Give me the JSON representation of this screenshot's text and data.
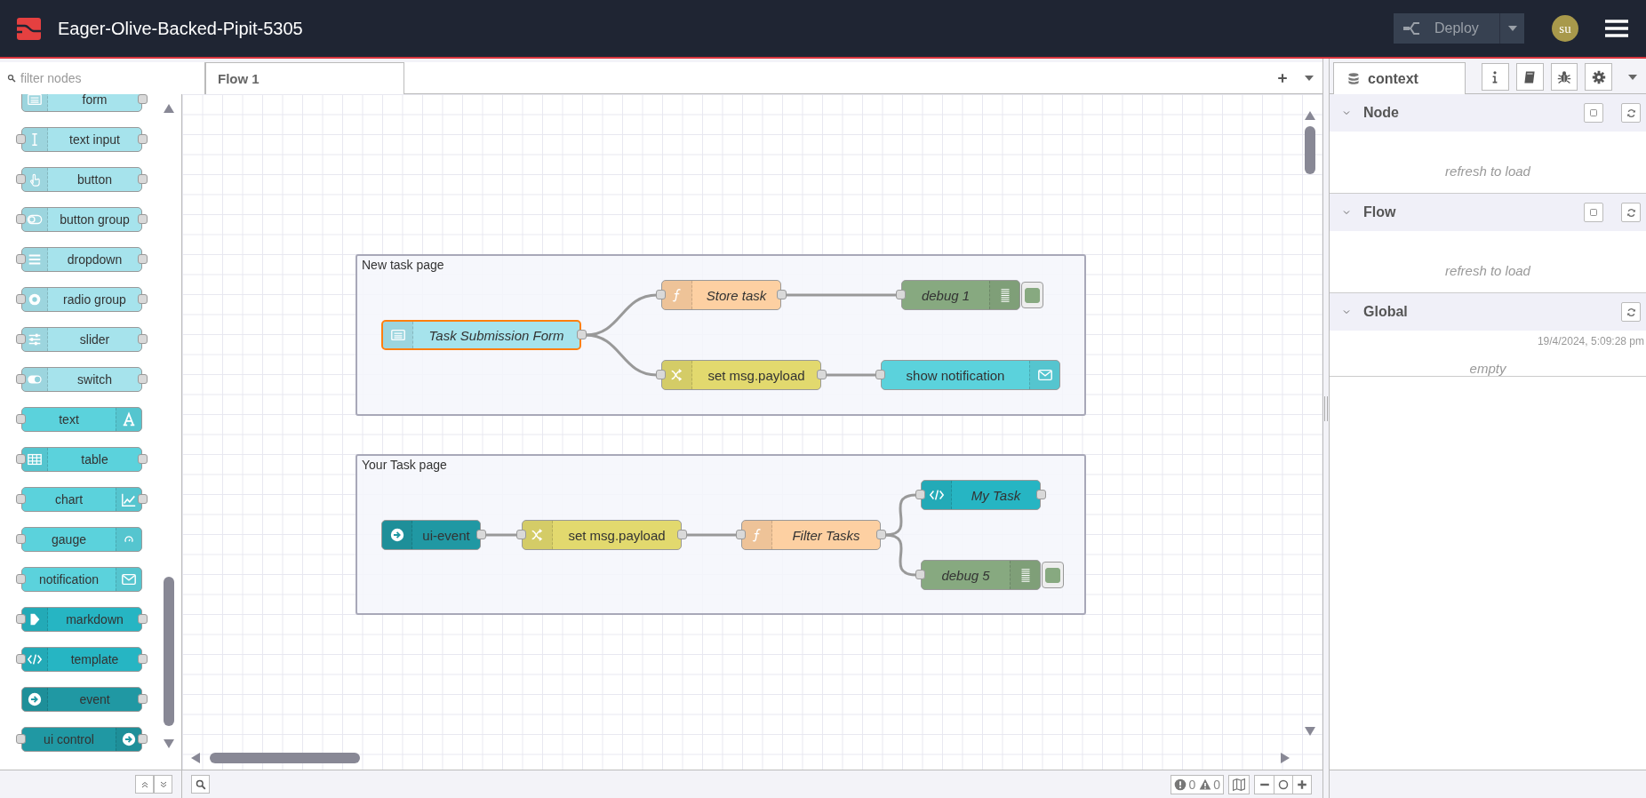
{
  "header": {
    "title": "Eager-Olive-Backed-Pipit-5305",
    "deploy": {
      "label": "Deploy",
      "disabled": true
    },
    "avatar": "su"
  },
  "palette": {
    "filter": {
      "placeholder": "filter nodes"
    },
    "nodes": [
      {
        "label": "form",
        "kind": "form",
        "color": "#a6e3ec",
        "input": false,
        "output": true
      },
      {
        "label": "text input",
        "kind": "text-input",
        "color": "#a6e3ec",
        "input": true,
        "output": true
      },
      {
        "label": "button",
        "kind": "button",
        "color": "#a6e3ec",
        "input": true,
        "output": true
      },
      {
        "label": "button group",
        "kind": "button-group",
        "color": "#a6e3ec",
        "input": true,
        "output": true
      },
      {
        "label": "dropdown",
        "kind": "dropdown",
        "color": "#a6e3ec",
        "input": true,
        "output": true
      },
      {
        "label": "radio group",
        "kind": "radio",
        "color": "#a6e3ec",
        "input": true,
        "output": true
      },
      {
        "label": "slider",
        "kind": "slider",
        "color": "#a6e3ec",
        "input": true,
        "output": true
      },
      {
        "label": "switch",
        "kind": "switch",
        "color": "#a6e3ec",
        "input": true,
        "output": true
      },
      {
        "label": "text",
        "kind": "text",
        "color": "#5bd2dc",
        "input": true,
        "output": false
      },
      {
        "label": "table",
        "kind": "table",
        "color": "#5bd2dc",
        "input": true,
        "output": true
      },
      {
        "label": "chart",
        "kind": "chart",
        "color": "#5bd2dc",
        "input": true,
        "output": true
      },
      {
        "label": "gauge",
        "kind": "gauge",
        "color": "#5bd2dc",
        "input": true,
        "output": false
      },
      {
        "label": "notification",
        "kind": "notification",
        "color": "#5bd2dc",
        "input": true,
        "output": false
      },
      {
        "label": "markdown",
        "kind": "markdown",
        "color": "#26b5c3",
        "input": true,
        "output": true
      },
      {
        "label": "template",
        "kind": "template",
        "color": "#26b5c3",
        "input": true,
        "output": true
      },
      {
        "label": "event",
        "kind": "event",
        "color": "#2098a3",
        "input": false,
        "output": true
      },
      {
        "label": "ui control",
        "kind": "control",
        "color": "#2098a3",
        "input": true,
        "output": true
      }
    ]
  },
  "workspace": {
    "tabs": [
      {
        "label": "Flow 1",
        "selected": true
      }
    ],
    "groups": [
      {
        "label": "New task page"
      },
      {
        "label": "Your Task page"
      }
    ],
    "nodes": [
      {
        "label": "Task Submission Form",
        "kind": "form",
        "color": "#a6e3ec",
        "italic": true,
        "selected": true,
        "input": false,
        "output": true
      },
      {
        "label": "Store task",
        "kind": "function",
        "color": "#fdd0a2",
        "italic": true,
        "selected": false,
        "input": true,
        "output": true
      },
      {
        "label": "debug 1",
        "kind": "debug",
        "color": "#87a980",
        "italic": true,
        "selected": false,
        "input": true,
        "output": false,
        "active": true
      },
      {
        "label": "set msg.payload",
        "kind": "change",
        "color": "#e2d96e",
        "italic": false,
        "selected": false,
        "input": true,
        "output": true
      },
      {
        "label": "show notification",
        "kind": "notification",
        "color": "#5bd2dc",
        "italic": false,
        "selected": false,
        "input": true,
        "output": false
      },
      {
        "label": "ui-event",
        "kind": "event",
        "color": "#2098a3",
        "italic": false,
        "selected": false,
        "input": false,
        "output": true
      },
      {
        "label": "set msg.payload",
        "kind": "change",
        "color": "#e2d96e",
        "italic": false,
        "selected": false,
        "input": true,
        "output": true
      },
      {
        "label": "Filter Tasks",
        "kind": "function",
        "color": "#fdd0a2",
        "italic": true,
        "selected": false,
        "input": true,
        "output": true
      },
      {
        "label": "My Task",
        "kind": "template",
        "color": "#26b5c3",
        "italic": true,
        "selected": false,
        "input": true,
        "output": true
      },
      {
        "label": "debug 5",
        "kind": "debug",
        "color": "#87a980",
        "italic": true,
        "selected": false,
        "input": true,
        "output": false,
        "active": true
      }
    ]
  },
  "footer": {
    "errors": "0",
    "warnings": "0"
  },
  "sidebar": {
    "tabs": [
      {
        "label": "context",
        "kind": "database",
        "selected": true
      },
      {
        "kind": "info",
        "selected": false
      },
      {
        "kind": "book",
        "selected": false
      },
      {
        "kind": "bug",
        "selected": false
      },
      {
        "kind": "gear",
        "selected": false
      }
    ],
    "sections": [
      {
        "title": "Node",
        "expanded": true,
        "buttons": [
          {
            "kind": "square"
          },
          {
            "kind": "refresh"
          }
        ],
        "message": "refresh to load"
      },
      {
        "title": "Flow",
        "expanded": true,
        "buttons": [
          {
            "kind": "square"
          },
          {
            "kind": "refresh"
          }
        ],
        "message": "refresh to load"
      },
      {
        "title": "Global",
        "expanded": true,
        "buttons": [
          {
            "kind": "refresh"
          }
        ],
        "timestamp": "19/4/2024, 5:09:28 pm",
        "message": "empty"
      }
    ]
  }
}
